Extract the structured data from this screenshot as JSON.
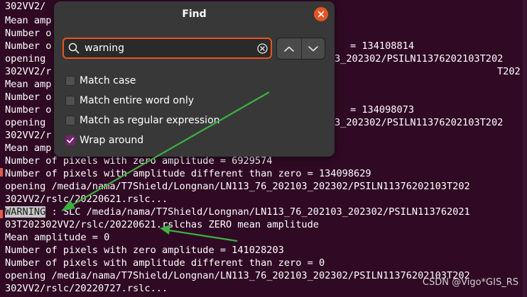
{
  "terminal": {
    "lines": [
      "302VV2/",
      "Mean amp",
      "Number o",
      "Number o",
      "opening ",
      "302VV2/r",
      "Mean amp",
      "Number o",
      "Number o",
      "opening ",
      "302VV2/r",
      "Mean amp",
      "Number of pixels with zero amplitude = 6929574",
      "Number of pixels with amplitude different than zero = 134098629",
      "opening /media/nama/T7Shield/Longnan/LN113_76_202103_202302/PSILN11376202103T202",
      "302VV2/rslc/20220621.rslc...",
      "",
      "03T202302VV2/rslc/20220621.rslchas ZERO mean amplitude",
      "Mean amplitude = 0",
      "Number of pixels with zero amplitude = 141028203",
      "Number of pixels with amplitude different than zero = 0",
      "opening /media/nama/T7Shield/Longnan/LN113_76_202103_202302/PSILN11376202103T202",
      "302VV2/rslc/20220727.rslc..."
    ],
    "right_fragments": [
      {
        "line": 3,
        "text": "= 134108814"
      },
      {
        "line": 4,
        "text": "3_202302/PSILN11376202103T202"
      },
      {
        "line": 5,
        "text": "T202"
      },
      {
        "line": 8,
        "text": "= 134098073"
      },
      {
        "line": 9,
        "text": "3_202302/PSILN11376202103T202"
      }
    ],
    "warning_word": "WARNING",
    "warning_rest": " : SLC /media/nama/T7Shield/Longnan/LN113_76_202103_202302/PSILN113762021"
  },
  "find_dialog": {
    "title": "Find",
    "search": {
      "value": "warning",
      "placeholder": ""
    },
    "options": [
      {
        "label": "Match case",
        "checked": false
      },
      {
        "label": "Match entire word only",
        "checked": false
      },
      {
        "label": "Match as regular expression",
        "checked": false
      },
      {
        "label": "Wrap around",
        "checked": true
      }
    ],
    "icons": {
      "close": "close-icon",
      "search": "search-icon",
      "clear": "clear-icon",
      "previous": "chevron-up-icon",
      "next": "chevron-down-icon",
      "check": "checkmark-icon"
    }
  },
  "watermark": "CSDN @Vigo*GIS_RS",
  "colors": {
    "terminal_bg": "#300a24",
    "accent": "#e95420",
    "checkbox_checked": "#77216f",
    "arrow": "#3cb043"
  }
}
